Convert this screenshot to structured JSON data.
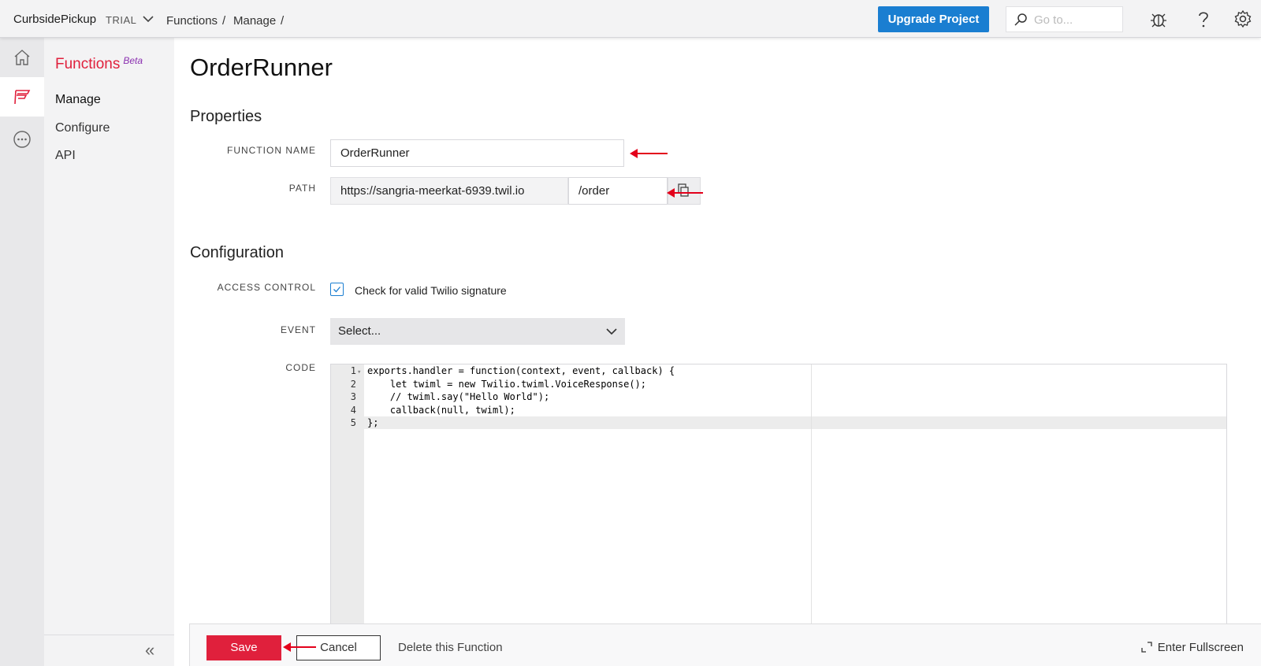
{
  "topbar": {
    "project": "CurbsidePickup",
    "trial": "TRIAL",
    "breadcrumb": [
      "Functions",
      "/",
      "Manage",
      "/"
    ],
    "upgrade": "Upgrade Project",
    "search_placeholder": "Go to..."
  },
  "subnav": {
    "title": "Functions",
    "beta": "Beta",
    "items": [
      "Manage",
      "Configure",
      "API"
    ],
    "collapse": "«"
  },
  "page": {
    "title": "OrderRunner",
    "properties_heading": "Properties",
    "function_name_label": "FUNCTION NAME",
    "function_name_value": "OrderRunner",
    "path_label": "PATH",
    "path_domain": "https://sangria-meerkat-6939.twil.io",
    "path_value": "/order",
    "configuration_heading": "Configuration",
    "access_control_label": "ACCESS CONTROL",
    "access_control_text": "Check for valid Twilio signature",
    "access_control_checked": true,
    "event_label": "EVENT",
    "event_value": "Select...",
    "code_label": "CODE"
  },
  "code": {
    "line_numbers": [
      "1",
      "2",
      "3",
      "4",
      "5"
    ],
    "lines": [
      "exports.handler = function(context, event, callback) {",
      "    let twiml = new Twilio.twiml.VoiceResponse();",
      "    // twiml.say(\"Hello World\");",
      "    callback(null, twiml);",
      "};"
    ]
  },
  "footer": {
    "save": "Save",
    "cancel": "Cancel",
    "delete": "Delete this Function",
    "fullscreen": "Enter Fullscreen"
  },
  "colors": {
    "brand_red": "#e0203c",
    "upgrade_blue": "#1a7ed1",
    "annotation_arrow": "#e3001b"
  }
}
